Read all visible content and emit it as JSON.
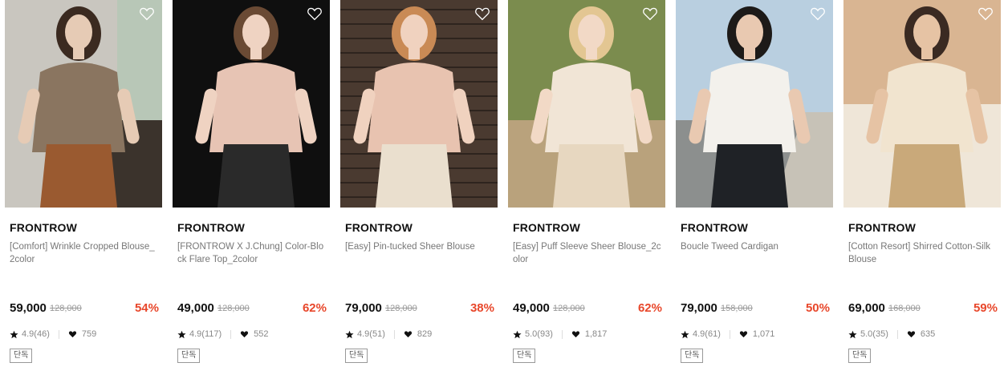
{
  "products": [
    {
      "brand": "FRONTROW",
      "title": "[Comfort] Wrinkle Cropped Blouse_2color",
      "price": "59,000",
      "original_price": "128,000",
      "discount": "54%",
      "rating": "4.9(46)",
      "likes": "759",
      "badge": "단독",
      "image": {
        "bg": "#c9c6bf",
        "outfit": "#8a7560",
        "skin": "#e6cbb5",
        "hair": "#3b2a20",
        "accent": "#9a5a30"
      }
    },
    {
      "brand": "FRONTROW",
      "title": "[FRONTROW X J.Chung] Color-Block Flare Top_2color",
      "price": "49,000",
      "original_price": "128,000",
      "discount": "62%",
      "rating": "4.9(117)",
      "likes": "552",
      "badge": "단독",
      "image": {
        "bg": "#0f0f0f",
        "outfit": "#e7c4b4",
        "skin": "#efd3c2",
        "hair": "#6a4a34",
        "accent": "#2a2a2a"
      }
    },
    {
      "brand": "FRONTROW",
      "title": "[Easy] Pin-tucked Sheer Blouse",
      "price": "79,000",
      "original_price": "128,000",
      "discount": "38%",
      "rating": "4.9(51)",
      "likes": "829",
      "badge": "단독",
      "image": {
        "bg": "#4a3a30",
        "outfit": "#e8c3b0",
        "skin": "#f0d2bf",
        "hair": "#c98a55",
        "accent": "#eadfce"
      }
    },
    {
      "brand": "FRONTROW",
      "title": "[Easy] Puff Sleeve Sheer Blouse_2color",
      "price": "49,000",
      "original_price": "128,000",
      "discount": "62%",
      "rating": "5.0(93)",
      "likes": "1,817",
      "badge": "단독",
      "image": {
        "bg": "#7b8c4e",
        "outfit": "#f1e5d6",
        "skin": "#f2d9c6",
        "hair": "#e3c692",
        "accent": "#e7d7c0"
      }
    },
    {
      "brand": "FRONTROW",
      "title": "Boucle Tweed Cardigan",
      "price": "79,000",
      "original_price": "158,000",
      "discount": "50%",
      "rating": "4.9(61)",
      "likes": "1,071",
      "badge": "단독",
      "image": {
        "bg": "#b9cfe0",
        "outfit": "#f3f1ec",
        "skin": "#e9c9b1",
        "hair": "#1d1a18",
        "accent": "#1f2226"
      }
    },
    {
      "brand": "FRONTROW",
      "title": "[Cotton Resort] Shirred Cotton-Silk Blouse",
      "price": "69,000",
      "original_price": "168,000",
      "discount": "59%",
      "rating": "5.0(35)",
      "likes": "635",
      "badge": "단독",
      "image": {
        "bg": "#d9b592",
        "outfit": "#f1e4cf",
        "skin": "#e6c3a4",
        "hair": "#3a2a22",
        "accent": "#c9a97a"
      }
    }
  ],
  "colors": {
    "discount": "#e8472b",
    "brand": "#111111",
    "muted": "#888888"
  },
  "icons": {
    "wishlist": "heart-outline-icon",
    "rating": "star-icon",
    "likes": "heart-icon"
  }
}
